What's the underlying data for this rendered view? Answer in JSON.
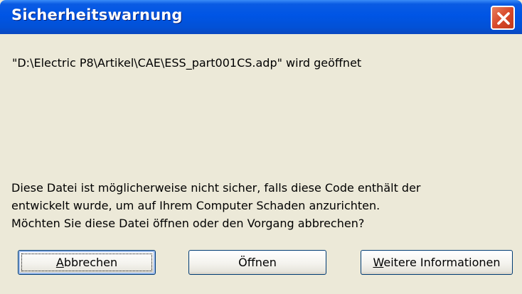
{
  "dialog": {
    "title": "Sicherheitswarnung",
    "close_icon": "close-icon",
    "file_message": "\"D:\\Electric P8\\Artikel\\CAE\\ESS_part001CS.adp\" wird geöffnet",
    "warning_lines": [
      "Diese Datei ist möglicherweise nicht sicher, falls diese Code enthält der",
      "entwickelt wurde, um auf Ihrem Computer Schaden anzurichten.",
      "Möchten Sie diese Datei öffnen oder den Vorgang abbrechen?"
    ]
  },
  "buttons": {
    "cancel": {
      "accesskey": "A",
      "rest": "bbrechen"
    },
    "open_label": "Öffnen",
    "more_info": {
      "accesskey": "W",
      "rest": "eitere Informationen"
    }
  },
  "colors": {
    "titlebar": "#0055e5",
    "dialog_bg": "#ece9d8",
    "close_button": "#d8492a",
    "button_border": "#003c74"
  }
}
